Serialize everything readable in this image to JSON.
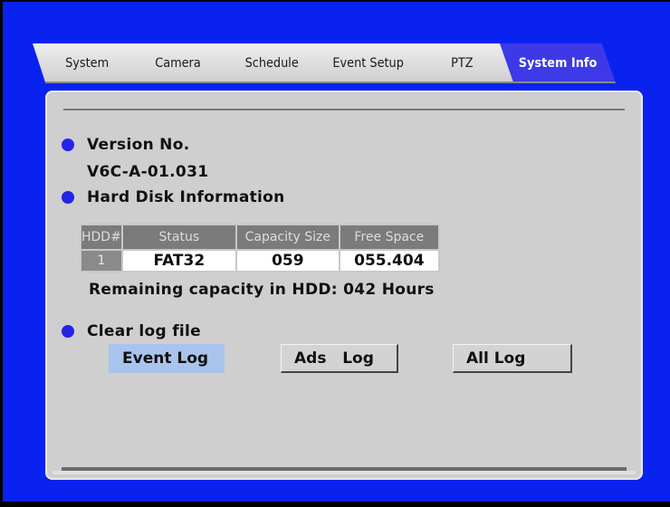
{
  "tabs": [
    {
      "label": "System",
      "active": false
    },
    {
      "label": "Camera",
      "active": false
    },
    {
      "label": "Schedule",
      "active": false
    },
    {
      "label": "Event Setup",
      "active": false
    },
    {
      "label": "PTZ",
      "active": false
    },
    {
      "label": "System Info",
      "active": true
    }
  ],
  "version": {
    "heading": "Version No.",
    "value": "V6C-A-01.031"
  },
  "hdd": {
    "heading": "Hard Disk Information",
    "columns": [
      "HDD#",
      "Status",
      "Capacity Size",
      "Free Space"
    ],
    "rows": [
      [
        "1",
        "FAT32",
        "059",
        "055.404"
      ]
    ],
    "remaining": "Remaining capacity in HDD: 042 Hours"
  },
  "clear_log": {
    "heading": "Clear log file",
    "buttons": [
      "Event Log",
      "Ads   Log",
      "All Log"
    ],
    "selected_index": 0
  },
  "colors": {
    "background": "#0a22f0",
    "active_tab": "#3e39e6",
    "bullet": "#2424e8",
    "selected_button": "#a9c4ec"
  }
}
